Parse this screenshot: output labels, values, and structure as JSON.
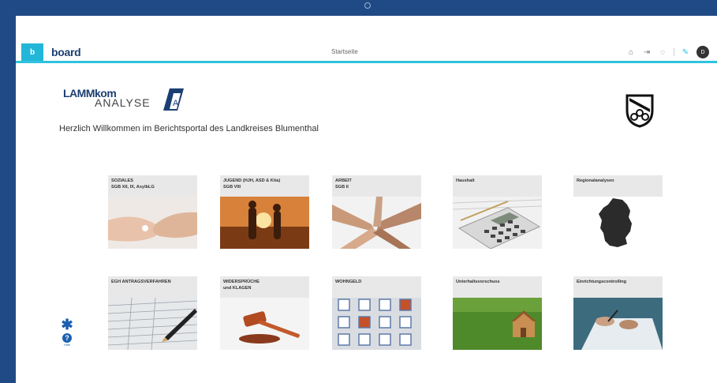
{
  "app": {
    "logo_letter": "b",
    "brand": "board",
    "page_title": "Startseite",
    "user_initials": "D"
  },
  "toolbar": {
    "icons": [
      "home-icon",
      "exit-icon",
      "chat-icon",
      "edit-icon"
    ],
    "glyphs": [
      "⌂",
      "⇥",
      "◌",
      "✎"
    ]
  },
  "header": {
    "logo_top_italic": "LAMM",
    "logo_top_normal": "kom",
    "logo_bottom": "ANALYSE",
    "logo_badge": "A",
    "welcome": "Herzlich Willkommen im Berichtsportal des Landkreises Blumenthal"
  },
  "tiles": [
    {
      "line1": "SOZIALES",
      "line2": "SGB XII, IX, AsylbLG",
      "image": "hands"
    },
    {
      "line1": "JUGEND (HJH, ASD & Kita)",
      "line2": "SGB VIII",
      "image": "sunset-family"
    },
    {
      "line1": "ARBEIT",
      "line2": "SGB II",
      "image": "team-hands"
    },
    {
      "line1": "Haushalt",
      "line2": "",
      "image": "calculator"
    },
    {
      "line1": "Regionalanalysen",
      "line2": "",
      "image": "germany-map"
    },
    {
      "line1": "EGH ANTRAGSVERFAHREN",
      "line2": "",
      "image": "form-pen"
    },
    {
      "line1": "WIDERSPRÜCHE",
      "line2": "und KLAGEN",
      "image": "gavel"
    },
    {
      "line1": "WOHNGELD",
      "line2": "",
      "image": "building-windows"
    },
    {
      "line1": "Unterhaltsvorschuss",
      "line2": "",
      "image": "house-grass"
    },
    {
      "line1": "Einrichtungscontrolling",
      "line2": "",
      "image": "writing-desk"
    }
  ],
  "help": {
    "label": "Hilfe",
    "q": "?",
    "star": "✱"
  },
  "colors": {
    "accent": "#2ec3df",
    "brand": "#1b3f73",
    "frame": "#1f4a86"
  }
}
